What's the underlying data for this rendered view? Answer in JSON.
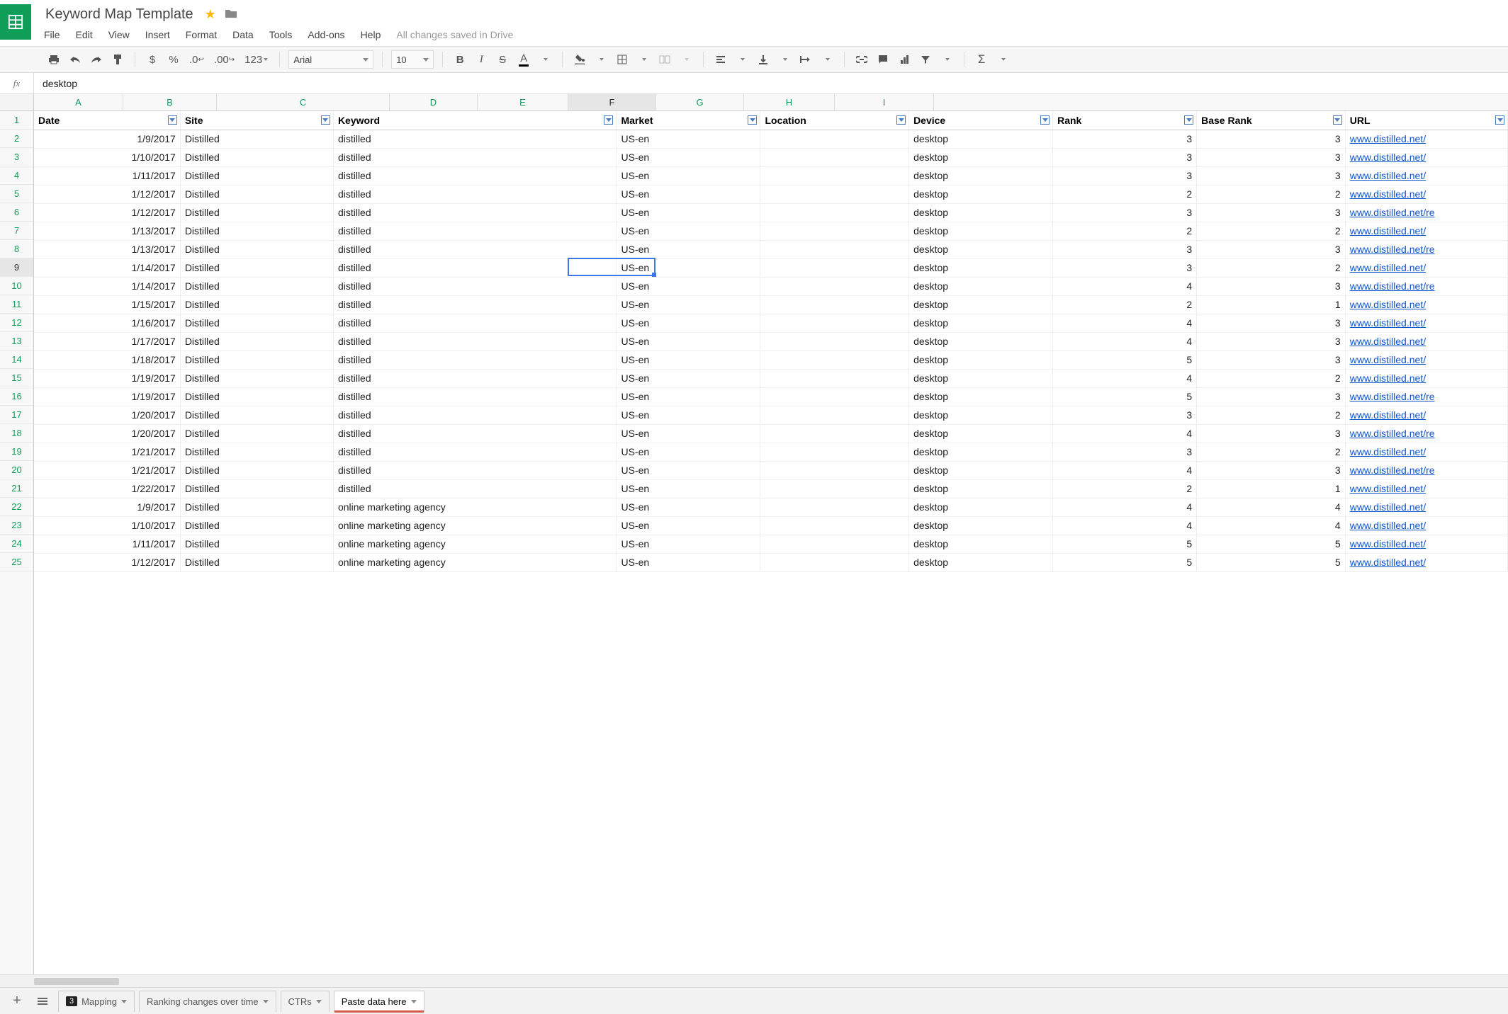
{
  "header": {
    "doc_title": "Keyword Map Template",
    "saved_status": "All changes saved in Drive",
    "menus": [
      "File",
      "Edit",
      "View",
      "Insert",
      "Format",
      "Data",
      "Tools",
      "Add-ons",
      "Help"
    ]
  },
  "toolbar": {
    "font": "Arial",
    "size": "10",
    "currency_sign": "$",
    "percent_sign": "%",
    "dec_minus": ".0",
    "dec_plus": ".00",
    "number_format": "123",
    "bold": "B",
    "italic": "I",
    "strike": "S",
    "textA": "A",
    "sigma": "Σ"
  },
  "formula_bar": {
    "fx": "fx",
    "value": "desktop"
  },
  "grid": {
    "column_letters": [
      "A",
      "B",
      "C",
      "D",
      "E",
      "F",
      "G",
      "H",
      "I"
    ],
    "headers": [
      "Date",
      "Site",
      "Keyword",
      "Market",
      "Location",
      "Device",
      "Rank",
      "Base Rank",
      "URL"
    ],
    "selected_col": "F",
    "selected_row": 9,
    "row_count": 25,
    "rows": [
      {
        "date": "1/9/2017",
        "site": "Distilled",
        "keyword": "distilled",
        "market": "US-en",
        "location": "",
        "device": "desktop",
        "rank": "3",
        "base": "3",
        "url": "www.distilled.net/"
      },
      {
        "date": "1/10/2017",
        "site": "Distilled",
        "keyword": "distilled",
        "market": "US-en",
        "location": "",
        "device": "desktop",
        "rank": "3",
        "base": "3",
        "url": "www.distilled.net/"
      },
      {
        "date": "1/11/2017",
        "site": "Distilled",
        "keyword": "distilled",
        "market": "US-en",
        "location": "",
        "device": "desktop",
        "rank": "3",
        "base": "3",
        "url": "www.distilled.net/"
      },
      {
        "date": "1/12/2017",
        "site": "Distilled",
        "keyword": "distilled",
        "market": "US-en",
        "location": "",
        "device": "desktop",
        "rank": "2",
        "base": "2",
        "url": "www.distilled.net/"
      },
      {
        "date": "1/12/2017",
        "site": "Distilled",
        "keyword": "distilled",
        "market": "US-en",
        "location": "",
        "device": "desktop",
        "rank": "3",
        "base": "3",
        "url": "www.distilled.net/re"
      },
      {
        "date": "1/13/2017",
        "site": "Distilled",
        "keyword": "distilled",
        "market": "US-en",
        "location": "",
        "device": "desktop",
        "rank": "2",
        "base": "2",
        "url": "www.distilled.net/"
      },
      {
        "date": "1/13/2017",
        "site": "Distilled",
        "keyword": "distilled",
        "market": "US-en",
        "location": "",
        "device": "desktop",
        "rank": "3",
        "base": "3",
        "url": "www.distilled.net/re"
      },
      {
        "date": "1/14/2017",
        "site": "Distilled",
        "keyword": "distilled",
        "market": "US-en",
        "location": "",
        "device": "desktop",
        "rank": "3",
        "base": "2",
        "url": "www.distilled.net/"
      },
      {
        "date": "1/14/2017",
        "site": "Distilled",
        "keyword": "distilled",
        "market": "US-en",
        "location": "",
        "device": "desktop",
        "rank": "4",
        "base": "3",
        "url": "www.distilled.net/re"
      },
      {
        "date": "1/15/2017",
        "site": "Distilled",
        "keyword": "distilled",
        "market": "US-en",
        "location": "",
        "device": "desktop",
        "rank": "2",
        "base": "1",
        "url": "www.distilled.net/"
      },
      {
        "date": "1/16/2017",
        "site": "Distilled",
        "keyword": "distilled",
        "market": "US-en",
        "location": "",
        "device": "desktop",
        "rank": "4",
        "base": "3",
        "url": "www.distilled.net/"
      },
      {
        "date": "1/17/2017",
        "site": "Distilled",
        "keyword": "distilled",
        "market": "US-en",
        "location": "",
        "device": "desktop",
        "rank": "4",
        "base": "3",
        "url": "www.distilled.net/"
      },
      {
        "date": "1/18/2017",
        "site": "Distilled",
        "keyword": "distilled",
        "market": "US-en",
        "location": "",
        "device": "desktop",
        "rank": "5",
        "base": "3",
        "url": "www.distilled.net/"
      },
      {
        "date": "1/19/2017",
        "site": "Distilled",
        "keyword": "distilled",
        "market": "US-en",
        "location": "",
        "device": "desktop",
        "rank": "4",
        "base": "2",
        "url": "www.distilled.net/"
      },
      {
        "date": "1/19/2017",
        "site": "Distilled",
        "keyword": "distilled",
        "market": "US-en",
        "location": "",
        "device": "desktop",
        "rank": "5",
        "base": "3",
        "url": "www.distilled.net/re"
      },
      {
        "date": "1/20/2017",
        "site": "Distilled",
        "keyword": "distilled",
        "market": "US-en",
        "location": "",
        "device": "desktop",
        "rank": "3",
        "base": "2",
        "url": "www.distilled.net/"
      },
      {
        "date": "1/20/2017",
        "site": "Distilled",
        "keyword": "distilled",
        "market": "US-en",
        "location": "",
        "device": "desktop",
        "rank": "4",
        "base": "3",
        "url": "www.distilled.net/re"
      },
      {
        "date": "1/21/2017",
        "site": "Distilled",
        "keyword": "distilled",
        "market": "US-en",
        "location": "",
        "device": "desktop",
        "rank": "3",
        "base": "2",
        "url": "www.distilled.net/"
      },
      {
        "date": "1/21/2017",
        "site": "Distilled",
        "keyword": "distilled",
        "market": "US-en",
        "location": "",
        "device": "desktop",
        "rank": "4",
        "base": "3",
        "url": "www.distilled.net/re"
      },
      {
        "date": "1/22/2017",
        "site": "Distilled",
        "keyword": "distilled",
        "market": "US-en",
        "location": "",
        "device": "desktop",
        "rank": "2",
        "base": "1",
        "url": "www.distilled.net/"
      },
      {
        "date": "1/9/2017",
        "site": "Distilled",
        "keyword": "online marketing agency",
        "market": "US-en",
        "location": "",
        "device": "desktop",
        "rank": "4",
        "base": "4",
        "url": "www.distilled.net/"
      },
      {
        "date": "1/10/2017",
        "site": "Distilled",
        "keyword": "online marketing agency",
        "market": "US-en",
        "location": "",
        "device": "desktop",
        "rank": "4",
        "base": "4",
        "url": "www.distilled.net/"
      },
      {
        "date": "1/11/2017",
        "site": "Distilled",
        "keyword": "online marketing agency",
        "market": "US-en",
        "location": "",
        "device": "desktop",
        "rank": "5",
        "base": "5",
        "url": "www.distilled.net/"
      },
      {
        "date": "1/12/2017",
        "site": "Distilled",
        "keyword": "online marketing agency",
        "market": "US-en",
        "location": "",
        "device": "desktop",
        "rank": "5",
        "base": "5",
        "url": "www.distilled.net/"
      }
    ]
  },
  "tabs": {
    "add": "+",
    "items": [
      {
        "pill": "3",
        "label": "Mapping",
        "active": false,
        "color": ""
      },
      {
        "pill": "",
        "label": "Ranking changes over time",
        "active": false,
        "color": ""
      },
      {
        "pill": "",
        "label": "CTRs",
        "active": false,
        "color": ""
      },
      {
        "pill": "",
        "label": "Paste data here",
        "active": true,
        "color": "#d65a4a"
      }
    ]
  }
}
